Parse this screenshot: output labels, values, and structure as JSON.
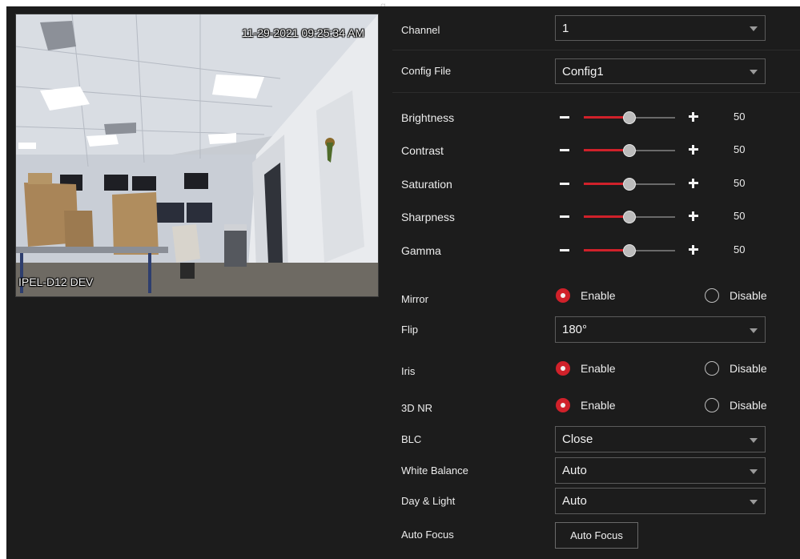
{
  "header_fragment": "g",
  "preview": {
    "timestamp": "11-29-2021 09:25:34 AM",
    "camera_name": "IPEL-D12 DEV"
  },
  "settings": {
    "channel": {
      "label": "Channel",
      "value": "1"
    },
    "config_file": {
      "label": "Config File",
      "value": "Config1"
    },
    "sliders": [
      {
        "label": "Brightness",
        "value": 50
      },
      {
        "label": "Contrast",
        "value": 50
      },
      {
        "label": "Saturation",
        "value": 50
      },
      {
        "label": "Sharpness",
        "value": 50
      },
      {
        "label": "Gamma",
        "value": 50
      }
    ],
    "mirror": {
      "label": "Mirror",
      "enable": "Enable",
      "disable": "Disable",
      "selected": "Enable"
    },
    "flip": {
      "label": "Flip",
      "value": "180°"
    },
    "iris": {
      "label": "Iris",
      "enable": "Enable",
      "disable": "Disable",
      "selected": "Enable"
    },
    "nr3d": {
      "label": "3D NR",
      "enable": "Enable",
      "disable": "Disable",
      "selected": "Enable"
    },
    "blc": {
      "label": "BLC",
      "value": "Close"
    },
    "white_balance": {
      "label": "White Balance",
      "value": "Auto"
    },
    "day_light": {
      "label": "Day & Light",
      "value": "Auto"
    },
    "auto_focus": {
      "label": "Auto Focus",
      "button": "Auto Focus"
    }
  },
  "colors": {
    "background": "#1c1c1c",
    "accent": "#d0212a",
    "text": "#ececec"
  }
}
